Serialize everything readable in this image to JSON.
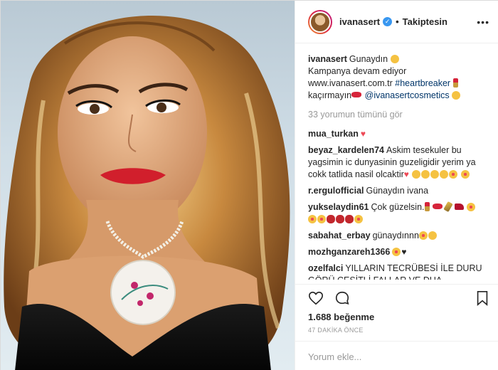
{
  "post": {
    "username": "ivanasert",
    "verified_icon": "verified-badge-icon",
    "separator": "•",
    "follow_label": "Takiptesin",
    "more_icon": "more-options-icon"
  },
  "caption": {
    "username": "ivanasert",
    "line1": "Gunaydın",
    "line2": "Kampanya devam ediyor",
    "link": "www.ivanasert.com.tr",
    "hashtag": "#heartbreaker",
    "line4": "kaçırmayın",
    "mention": "@ivanasertcosmetics"
  },
  "view_all": "33 yorumun tümünü gör",
  "comments": [
    {
      "user": "mua_turkan",
      "text": ""
    },
    {
      "user": "beyaz_kardelen74",
      "text": "Askim tesekuler bu yagsimin ic dunyasinin guzeligidir yerim ya cokk tatlida nasil olcaktir"
    },
    {
      "user": "r.ergulofficial",
      "text": "Günaydın ivana"
    },
    {
      "user": "yukselaydin61",
      "text": "Çok güzelsin."
    },
    {
      "user": "sabahat_erbay",
      "text": "günaydınnn"
    },
    {
      "user": "mozhganzareh1366",
      "text": ""
    },
    {
      "user": "ozelfalci",
      "text": "YILLARIN TECRÜBESİ İLE DURU GÖRÜ ÇEŞİTLİ FALLAR VE DUA İŞLEMLERİ İÇİN GERÇEK KİŞİ İLE DETAYLI VE EN"
    }
  ],
  "actions": {
    "like_icon": "heart-icon",
    "comment_icon": "comment-icon",
    "save_icon": "bookmark-icon"
  },
  "likes": "1.688 beğenme",
  "timestamp": "47 DAKİKA ÖNCE",
  "add_comment_placeholder": "Yorum ekle...",
  "colors": {
    "link": "#003569",
    "muted": "#999999",
    "verified": "#3897f0",
    "border": "#efefef"
  }
}
